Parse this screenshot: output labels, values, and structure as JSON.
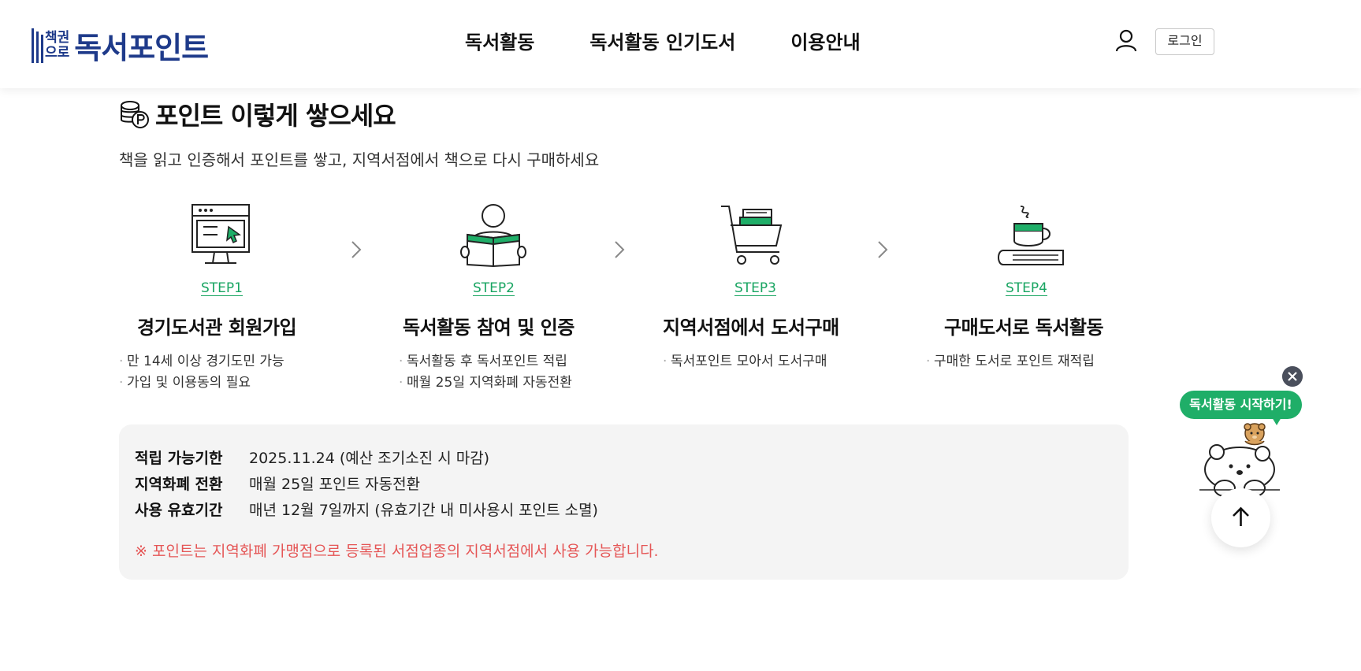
{
  "header": {
    "logo_small_top": "책권",
    "logo_small_bottom": "으로",
    "logo_main": "독서포인트",
    "nav": [
      "독서활동",
      "독서활동 인기도서",
      "이용안내"
    ],
    "login_label": "로그인",
    "icons": {
      "user": "user-icon"
    }
  },
  "section": {
    "title": "포인트 이렇게 쌓으세요",
    "subtitle": "책을 읽고 인증해서 포인트를 쌓고, 지역서점에서 책으로 다시 구매하세요",
    "title_icon": "coin-point-icon"
  },
  "steps": [
    {
      "label": "STEP1",
      "title": "경기도서관 회원가입",
      "icon": "computer-monitor-icon",
      "bullets": [
        "만 14세 이상 경기도민 가능",
        "가입 및 이용동의 필요"
      ]
    },
    {
      "label": "STEP2",
      "title": "독서활동 참여 및 인증",
      "icon": "person-reading-icon",
      "bullets": [
        "독서활동 후 독서포인트 적립",
        "매월 25일 지역화폐 자동전환"
      ]
    },
    {
      "label": "STEP3",
      "title": "지역서점에서 도서구매",
      "icon": "shopping-cart-books-icon",
      "bullets": [
        "독서포인트 모아서 도서구매"
      ]
    },
    {
      "label": "STEP4",
      "title": "구매도서로 독서활동",
      "icon": "coffee-cup-book-icon",
      "bullets": [
        "구매한 도서로 포인트 재적립"
      ]
    }
  ],
  "info": {
    "rows": [
      {
        "key": "적립 가능기한",
        "value": "2025.11.24 (예산 조기소진 시 마감)"
      },
      {
        "key": "지역화폐 전환",
        "value": "매월 25일 포인트 자동전환"
      },
      {
        "key": "사용 유효기간",
        "value": "매년 12월 7일까지 (유효기간 내 미사용시 포인트 소멸)"
      }
    ],
    "note": "※ 포인트는 지역화폐 가맹점으로 등록된 서점업종의 지역서점에서 사용 가능합니다."
  },
  "floating": {
    "bubble_label": "독서활동 시작하기!",
    "close_icon": "close-icon",
    "mascot": "bear-mascot",
    "top_icon": "arrow-up-icon"
  },
  "colors": {
    "brand_navy": "#1e3a8a",
    "accent_green": "#1fae68",
    "note_red": "#e55656",
    "box_bg": "#f4f4f4"
  }
}
